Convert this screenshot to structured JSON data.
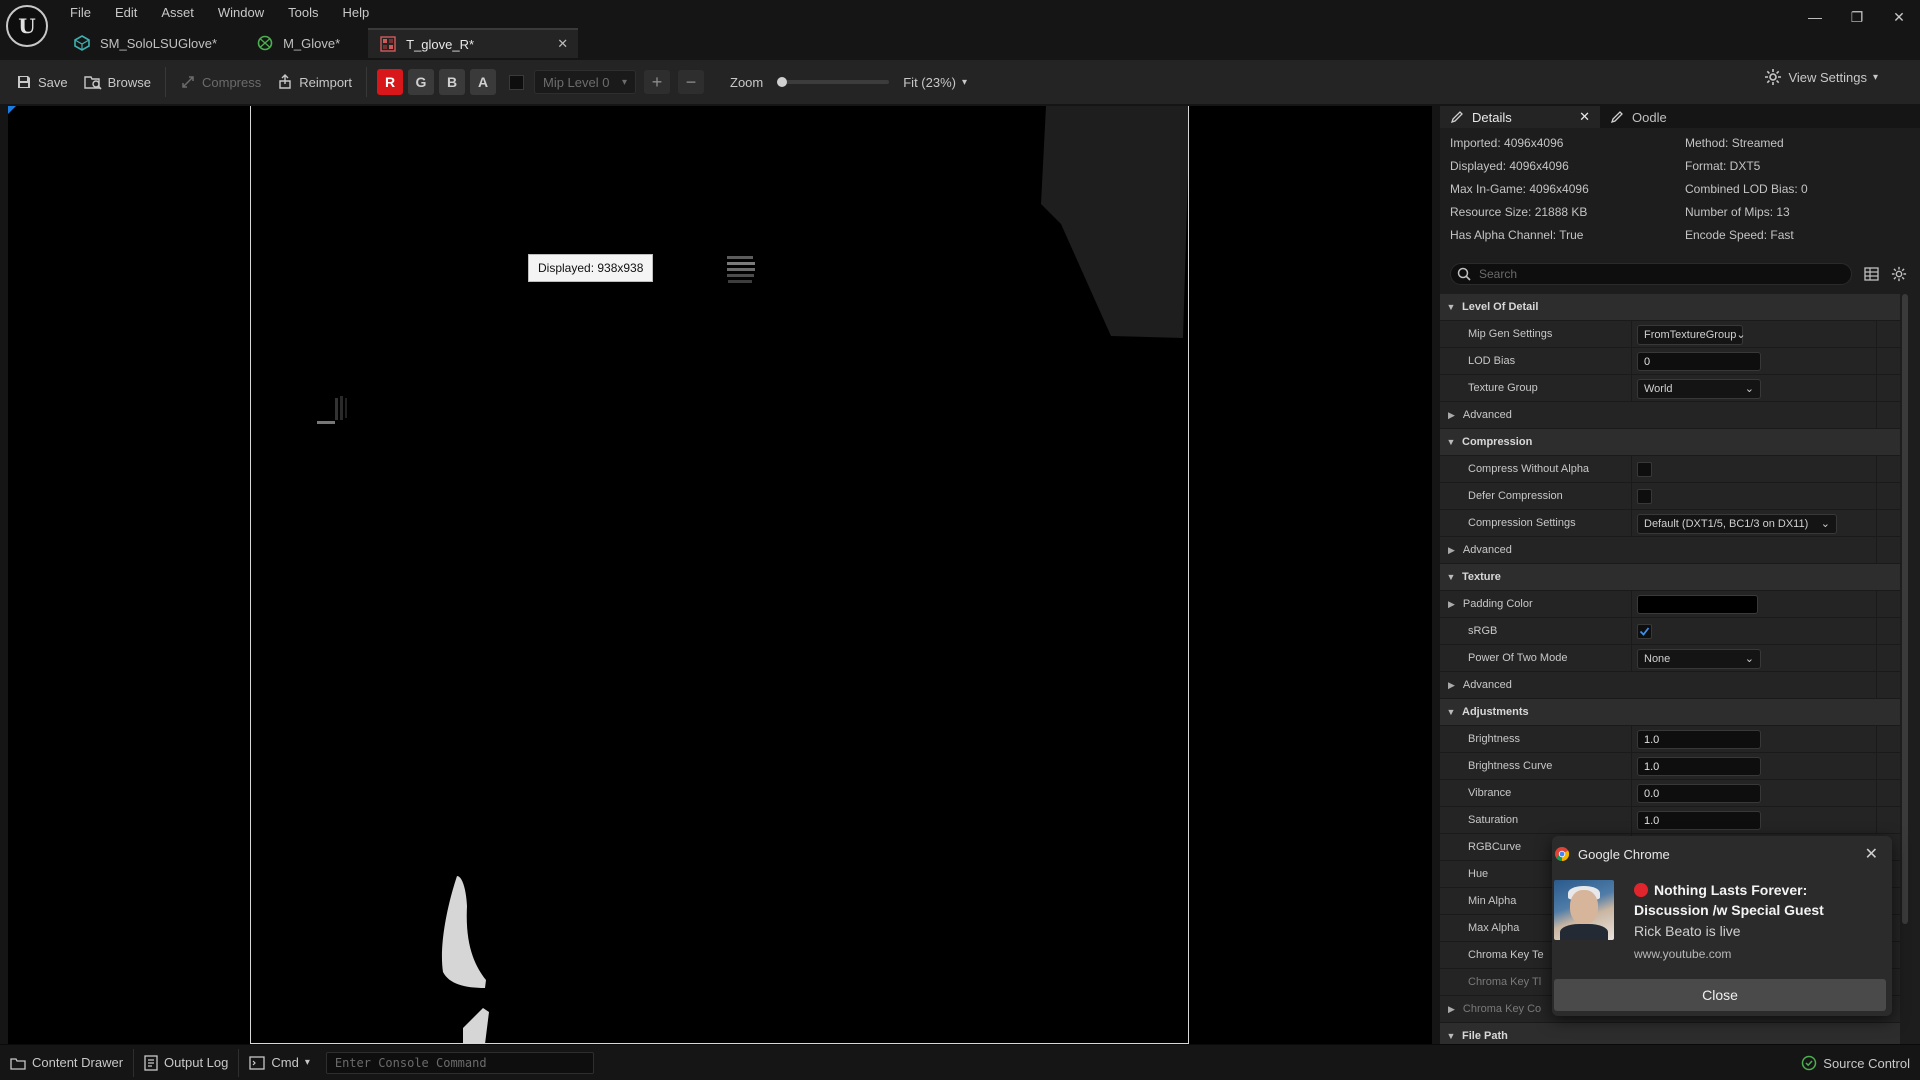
{
  "menu": [
    "File",
    "Edit",
    "Asset",
    "Window",
    "Tools",
    "Help"
  ],
  "window_controls": {
    "minimize": "—",
    "restore": "❐",
    "close": "✕"
  },
  "doc_tabs": [
    {
      "label": "SM_SoloLSUGlove*",
      "icon": "static-mesh-icon"
    },
    {
      "label": "M_Glove*",
      "icon": "material-icon"
    },
    {
      "label": "T_glove_R*",
      "icon": "texture-icon",
      "active": true
    }
  ],
  "toolbar": {
    "save": "Save",
    "browse": "Browse",
    "compress": "Compress",
    "reimport": "Reimport",
    "channels": [
      "R",
      "G",
      "B",
      "A"
    ],
    "mip_level": "Mip Level 0",
    "zoom_label": "Zoom",
    "zoom_fraction": 0.0,
    "fit": "Fit (23%)",
    "view_settings": "View Settings"
  },
  "viewport": {
    "tooltip": "Displayed: 938x938"
  },
  "panel_tabs": [
    {
      "label": "Details",
      "active": true
    },
    {
      "label": "Oodle"
    }
  ],
  "info": {
    "left": [
      "Imported: 4096x4096",
      "Displayed: 4096x4096",
      "Max In-Game: 4096x4096",
      "Resource Size: 21888 KB",
      "Has Alpha Channel: True"
    ],
    "right": [
      "Method: Streamed",
      "Format: DXT5",
      "Combined LOD Bias: 0",
      "Number of Mips: 13",
      "Encode Speed: Fast"
    ]
  },
  "search": {
    "placeholder": "Search"
  },
  "sections": {
    "lod": "Level Of Detail",
    "compression": "Compression",
    "texture": "Texture",
    "adjustments": "Adjustments",
    "file_path": "File Path"
  },
  "props": {
    "mip_gen_settings": {
      "label": "Mip Gen Settings",
      "value": "FromTextureGroup"
    },
    "lod_bias": {
      "label": "LOD Bias",
      "value": "0"
    },
    "texture_group": {
      "label": "Texture Group",
      "value": "World"
    },
    "advanced": "Advanced",
    "compress_without_alpha": {
      "label": "Compress Without Alpha",
      "checked": false
    },
    "defer_compression": {
      "label": "Defer Compression",
      "checked": false
    },
    "compression_settings": {
      "label": "Compression Settings",
      "value": "Default (DXT1/5, BC1/3 on DX11)"
    },
    "padding_color": {
      "label": "Padding Color",
      "color": "#000000"
    },
    "srgb": {
      "label": "sRGB",
      "checked": true
    },
    "power_of_two_mode": {
      "label": "Power Of Two Mode",
      "value": "None"
    },
    "brightness": {
      "label": "Brightness",
      "value": "1.0"
    },
    "brightness_curve": {
      "label": "Brightness Curve",
      "value": "1.0"
    },
    "vibrance": {
      "label": "Vibrance",
      "value": "0.0"
    },
    "saturation": {
      "label": "Saturation",
      "value": "1.0"
    },
    "rgb_curve": {
      "label": "RGBCurve"
    },
    "hue": {
      "label": "Hue"
    },
    "min_alpha": {
      "label": "Min Alpha"
    },
    "max_alpha": {
      "label": "Max Alpha"
    },
    "chroma_key_threshold": {
      "label": "Chroma Key Te"
    },
    "chroma_key_threshold2": {
      "label": "Chroma Key Tl"
    },
    "chroma_key_color": {
      "label": "Chroma Key Co"
    }
  },
  "notification": {
    "app": "Google Chrome",
    "title": "Nothing Lasts Forever: Discussion /w Special Guest",
    "subtitle": "Rick Beato is live",
    "url": "www.youtube.com",
    "close_button": "Close",
    "close_x": "✕"
  },
  "statusbar": {
    "content_drawer": "Content Drawer",
    "output_log": "Output Log",
    "cmd": "Cmd",
    "console_placeholder": "Enter Console Command",
    "source_control": "Source Control"
  },
  "colors": {
    "accent_red": "#d8171b",
    "selection_blue": "#1a7be0",
    "background": "#151515",
    "panel": "#242424"
  }
}
